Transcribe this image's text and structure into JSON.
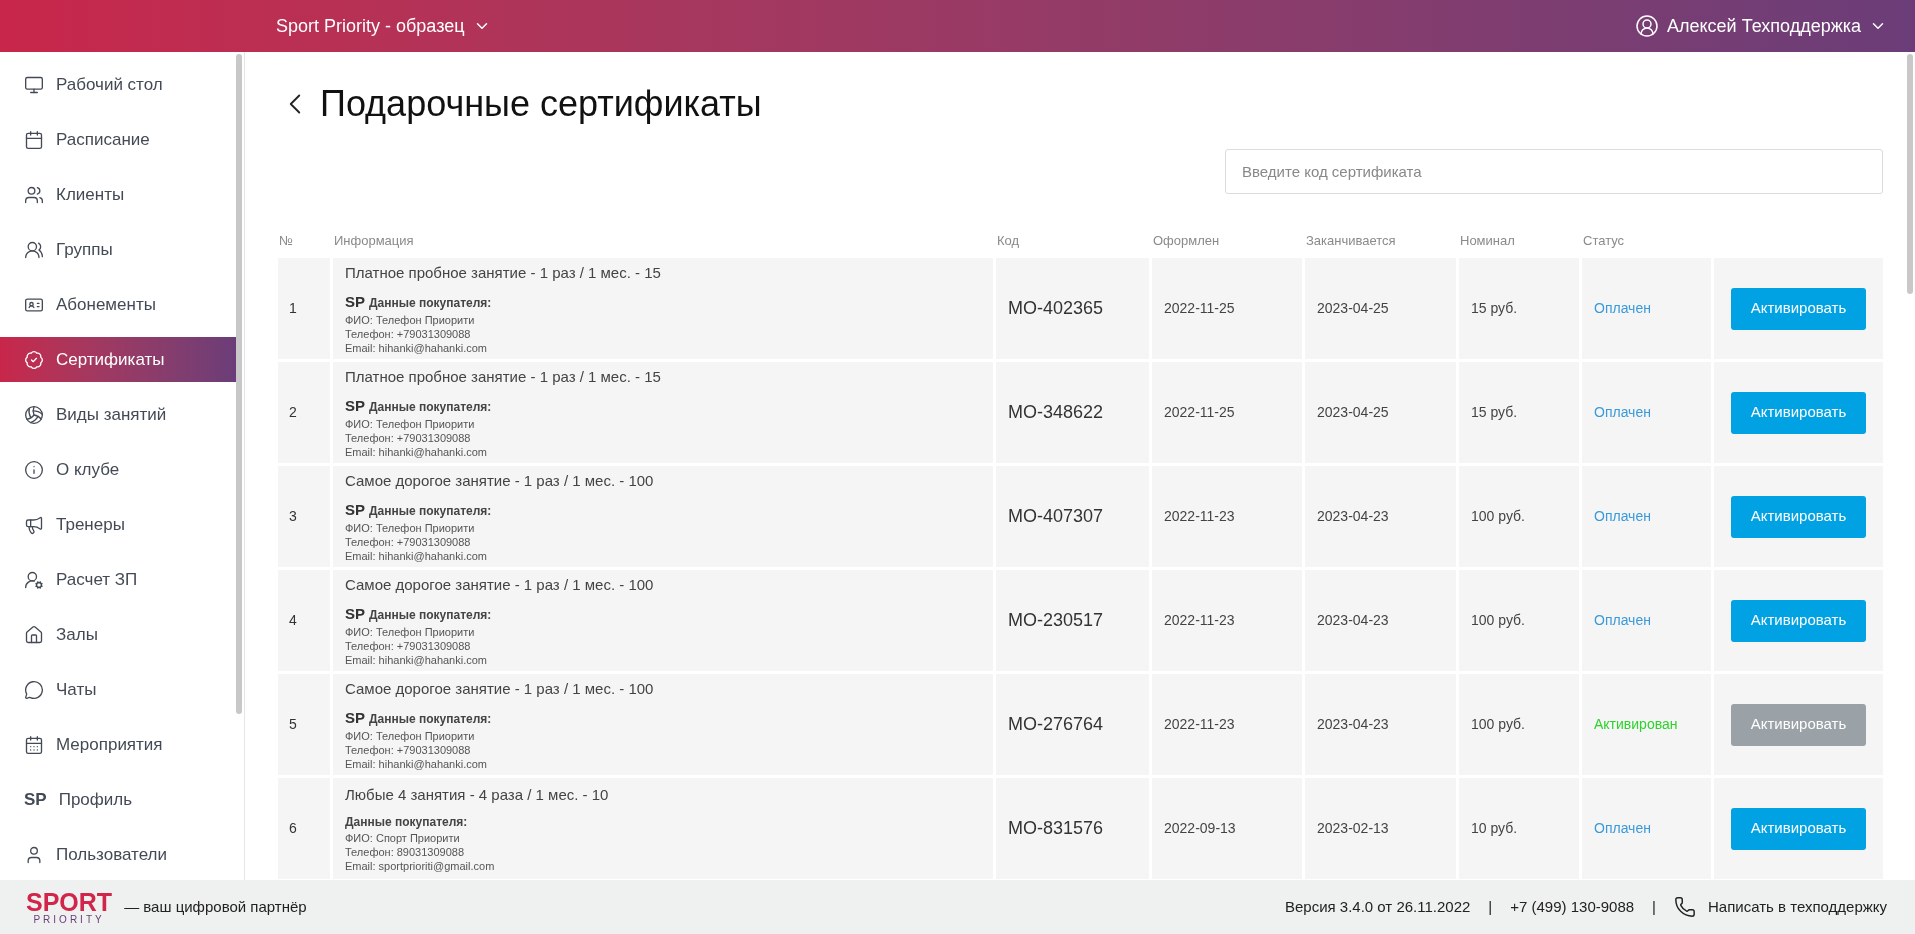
{
  "top_bar": {
    "organization": "Sport Priority - образец",
    "user": "Алексей Техподдержка"
  },
  "sidebar": {
    "items": [
      {
        "label": "Рабочий стол",
        "selected": false
      },
      {
        "label": "Расписание",
        "selected": false
      },
      {
        "label": "Клиенты",
        "selected": false
      },
      {
        "label": "Группы",
        "selected": false
      },
      {
        "label": "Абонементы",
        "selected": false
      },
      {
        "label": "Сертификаты",
        "selected": true
      },
      {
        "label": "Виды занятий",
        "selected": false
      },
      {
        "label": "О клубе",
        "selected": false
      },
      {
        "label": "Тренеры",
        "selected": false
      },
      {
        "label": "Расчет ЗП",
        "selected": false
      },
      {
        "label": "Залы",
        "selected": false
      },
      {
        "label": "Чаты",
        "selected": false
      },
      {
        "label": "Мероприятия",
        "selected": false
      },
      {
        "label": "Профиль",
        "selected": false,
        "badge": "SP"
      },
      {
        "label": "Пользователи",
        "selected": false
      }
    ]
  },
  "page": {
    "title": "Подарочные сертификаты",
    "search": {
      "placeholder": "Введите код сертификата"
    }
  },
  "table": {
    "columns": [
      "№",
      "Информация",
      "Код",
      "Оформлен",
      "Заканчивается",
      "Номинал",
      "Статус"
    ],
    "rows": [
      {
        "number": "1",
        "title": "Платное пробное занятие - 1 раз / 1 мес. - 15",
        "prefix": "SP",
        "buyer_heading": "Данные покупателя:",
        "buyer_lines": [
          "ФИО: Телефон Приорити",
          "Телефон: +79031309088",
          "Email: hihanki@hahanki.com"
        ],
        "code": "MO-402365",
        "issued": "2022-11-25",
        "expires": "2023-04-25",
        "nominal": "15 руб.",
        "status": "Оплачен",
        "kind": "paid",
        "action": "Активировать",
        "disabled": false
      },
      {
        "number": "2",
        "title": "Платное пробное занятие - 1 раз / 1 мес. - 15",
        "prefix": "SP",
        "buyer_heading": "Данные покупателя:",
        "buyer_lines": [
          "ФИО: Телефон Приорити",
          "Телефон: +79031309088",
          "Email: hihanki@hahanki.com"
        ],
        "code": "MO-348622",
        "issued": "2022-11-25",
        "expires": "2023-04-25",
        "nominal": "15 руб.",
        "status": "Оплачен",
        "kind": "paid",
        "action": "Активировать",
        "disabled": false
      },
      {
        "number": "3",
        "title": "Самое дорогое занятие - 1 раз / 1 мес. - 100",
        "prefix": "SP",
        "buyer_heading": "Данные покупателя:",
        "buyer_lines": [
          "ФИО: Телефон Приорити",
          "Телефон: +79031309088",
          "Email: hihanki@hahanki.com"
        ],
        "code": "MO-407307",
        "issued": "2022-11-23",
        "expires": "2023-04-23",
        "nominal": "100 руб.",
        "status": "Оплачен",
        "kind": "paid",
        "action": "Активировать",
        "disabled": false
      },
      {
        "number": "4",
        "title": "Самое дорогое занятие - 1 раз / 1 мес. - 100",
        "prefix": "SP",
        "buyer_heading": "Данные покупателя:",
        "buyer_lines": [
          "ФИО: Телефон Приорити",
          "Телефон: +79031309088",
          "Email: hihanki@hahanki.com"
        ],
        "code": "MO-230517",
        "issued": "2022-11-23",
        "expires": "2023-04-23",
        "nominal": "100 руб.",
        "status": "Оплачен",
        "kind": "paid",
        "action": "Активировать",
        "disabled": false
      },
      {
        "number": "5",
        "title": "Самое дорогое занятие - 1 раз / 1 мес. - 100",
        "prefix": "SP",
        "buyer_heading": "Данные покупателя:",
        "buyer_lines": [
          "ФИО: Телефон Приорити",
          "Телефон: +79031309088",
          "Email: hihanki@hahanki.com"
        ],
        "code": "MO-276764",
        "issued": "2022-11-23",
        "expires": "2023-04-23",
        "nominal": "100 руб.",
        "status": "Активирован",
        "kind": "activated",
        "action": "Активировать",
        "disabled": true
      },
      {
        "number": "6",
        "title": "Любые 4 занятия - 4 раза / 1 мес. - 10",
        "buyer_heading": "Данные покупателя:",
        "buyer_lines": [
          "ФИО: Спорт Приорити",
          "Телефон: 89031309088",
          "Email: sportprioriti@gmail.com"
        ],
        "code": "MO-831576",
        "issued": "2022-09-13",
        "expires": "2023-02-13",
        "nominal": "10 руб.",
        "status": "Оплачен",
        "kind": "paid",
        "action": "Активировать",
        "disabled": false
      }
    ]
  },
  "footer": {
    "logo_top": "SPORT",
    "logo_bottom": "PRIORITY",
    "slogan": "— ваш цифровой партнёр",
    "version": "Версия 3.4.0 от 26.11.2022",
    "separators": [
      "|",
      "|"
    ],
    "phone": "+7 (499) 130-9088",
    "support_link": "Написать в техподдержку"
  }
}
